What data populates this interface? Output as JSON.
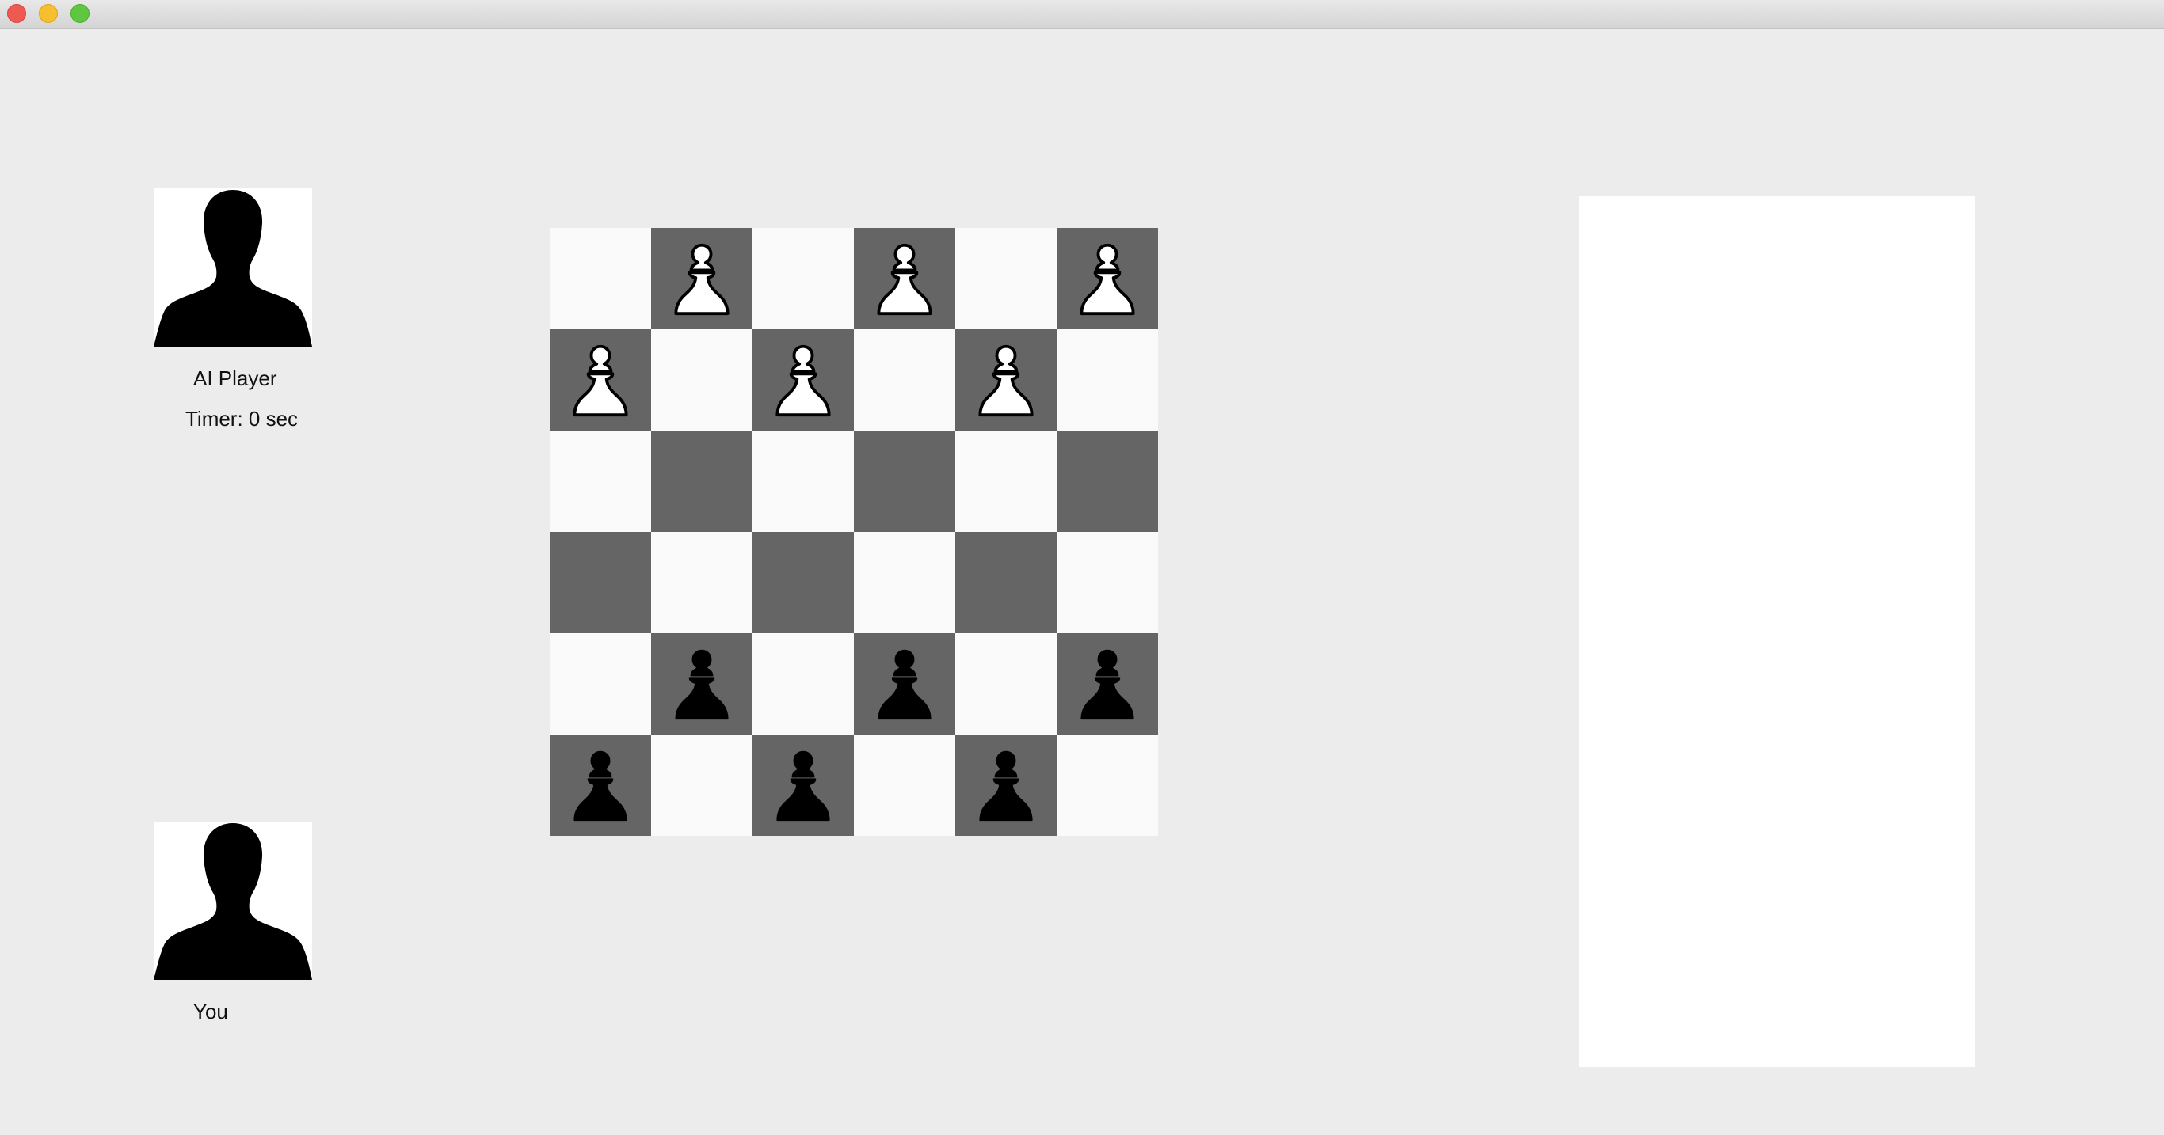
{
  "window": {
    "controls": [
      "close",
      "minimize",
      "zoom"
    ]
  },
  "opponent": {
    "name": "AI Player",
    "timer": "Timer: 0 sec",
    "avatar_icon": "person-silhouette-icon"
  },
  "player": {
    "name": "You",
    "avatar_icon": "person-silhouette-icon"
  },
  "board": {
    "size": 6,
    "light_color": "#fafafa",
    "dark_color": "#656565",
    "rows": [
      [
        "",
        "white-pawn",
        "",
        "white-pawn",
        "",
        "white-pawn"
      ],
      [
        "white-pawn",
        "",
        "white-pawn",
        "",
        "white-pawn",
        ""
      ],
      [
        "",
        "",
        "",
        "",
        "",
        ""
      ],
      [
        "",
        "",
        "",
        "",
        "",
        ""
      ],
      [
        "",
        "black-pawn",
        "",
        "black-pawn",
        "",
        "black-pawn"
      ],
      [
        "black-pawn",
        "",
        "black-pawn",
        "",
        "black-pawn",
        ""
      ]
    ]
  },
  "side_panel": {
    "content": ""
  }
}
